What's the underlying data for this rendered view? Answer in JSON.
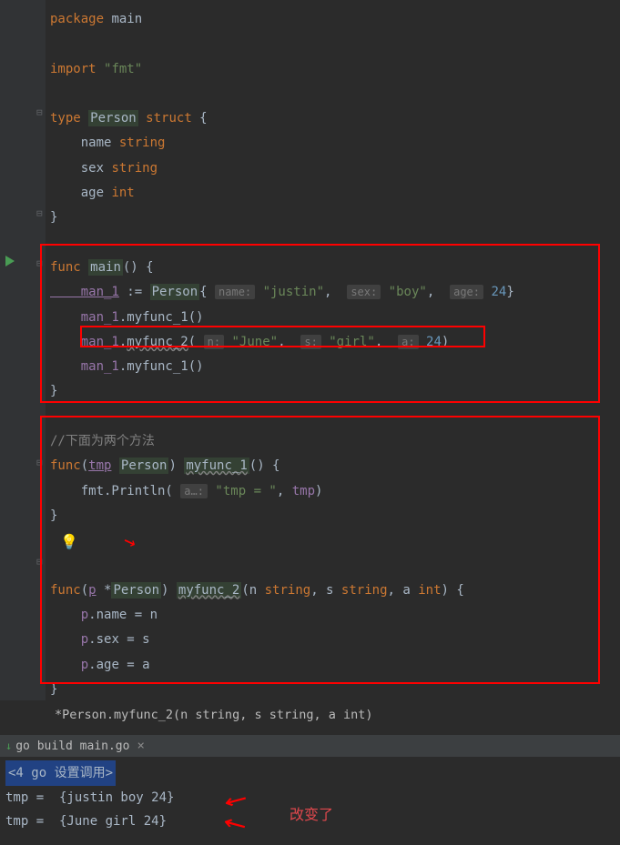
{
  "code": {
    "line1_package": "package",
    "line1_main": "main",
    "line3_import": "import",
    "line3_fmt": "\"fmt\"",
    "line5_type": "type",
    "line5_person": "Person",
    "line5_struct": "struct",
    "line5_brace": " {",
    "line6": "    name ",
    "line6_type": "string",
    "line7": "    sex ",
    "line7_type": "string",
    "line8": "    age ",
    "line8_type": "int",
    "line9": "}",
    "line11_func": "func",
    "line11_main": "main",
    "line11_rest": "() {",
    "line12_var": "    man_1",
    "line12_assign": " := ",
    "line12_type": "Person",
    "line12_brace": "{ ",
    "line12_h1": "name:",
    "line12_v1": "\"justin\"",
    "line12_c1": ",  ",
    "line12_h2": "sex:",
    "line12_v2": "\"boy\"",
    "line12_c2": ",  ",
    "line12_h3": "age:",
    "line12_v3": "24",
    "line12_end": "}",
    "line13_var": "    man_1",
    "line13_call": ".myfunc_1()",
    "line14_var": "    man_1",
    "line14_dot": ".",
    "line14_fn": "myfunc_2",
    "line14_p1": "( ",
    "line14_h1": "n:",
    "line14_v1": "\"June\"",
    "line14_c1": ",  ",
    "line14_h2": "s:",
    "line14_v2": "\"girl\"",
    "line14_c2": ",  ",
    "line14_h3": "a:",
    "line14_v3": "24",
    "line14_end": ")",
    "line15_var": "    man_1",
    "line15_call": ".myfunc_1()",
    "line16": "}",
    "line18_comment": "//下面为两个方法",
    "line19_func": "func",
    "line19_p1": "(",
    "line19_tmp": "tmp",
    "line19_sp": " ",
    "line19_type": "Person",
    "line19_p2": ") ",
    "line19_fn": "myfunc_1",
    "line19_end": "() {",
    "line20_pre": "    fmt.Println( ",
    "line20_hint": "a…:",
    "line20_str": "\"tmp = \"",
    "line20_c": ", ",
    "line20_var": "tmp",
    "line20_end": ")",
    "line21": "}",
    "line23_func": "func",
    "line23_p1": "(",
    "line23_p": "p",
    "line23_star": " *",
    "line23_type": "Person",
    "line23_p2": ") ",
    "line23_fn": "myfunc_2",
    "line23_args_p1": "(n ",
    "line23_t1": "string",
    "line23_c1": ", s ",
    "line23_t2": "string",
    "line23_c2": ", a ",
    "line23_t3": "int",
    "line23_end": ") {",
    "line24_pre": "    ",
    "line24_p": "p",
    "line24_rest": ".name = n",
    "line25_pre": "    ",
    "line25_p": "p",
    "line25_rest": ".sex = s",
    "line26_pre": "    ",
    "line26_p": "p",
    "line26_rest": ".age = a",
    "line27": "}"
  },
  "doc_hint": "*Person.myfunc_2(n string, s string, a int)",
  "build_tab": "go build main.go",
  "console": {
    "header": "<4 go 设置调用>",
    "line1": "tmp =  {justin boy 24}",
    "line2": "tmp =  {June girl 24}"
  },
  "annotations": {
    "changed": "改变了"
  }
}
